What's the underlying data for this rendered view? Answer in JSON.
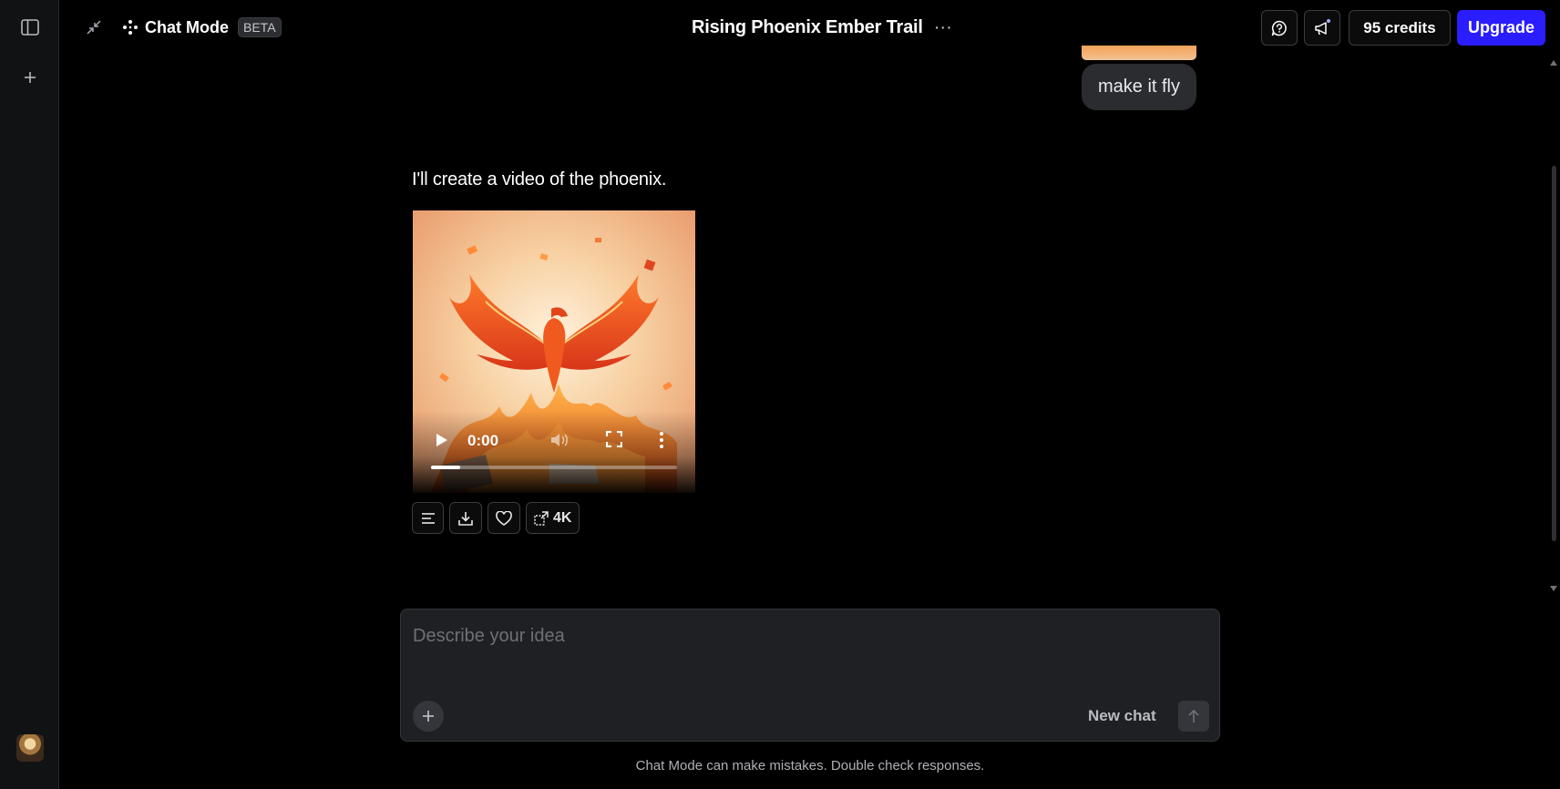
{
  "sidebar": {
    "toggle_icon": "sidebar-toggle-icon",
    "new_icon": "plus-icon",
    "avatar_icon": "user-avatar"
  },
  "header": {
    "mode_label": "Chat Mode",
    "beta_badge": "BETA",
    "chat_title": "Rising Phoenix Ember Trail",
    "credits": "95 credits",
    "upgrade_label": "Upgrade",
    "colors": {
      "upgrade_bg": "#2a1dff"
    }
  },
  "chat": {
    "user_message": "make it fly",
    "assistant_text": "I'll create a video of the phoenix.",
    "video": {
      "time": "0:00",
      "progress": 0.12
    },
    "actions": {
      "upscale_label": "4K"
    }
  },
  "composer": {
    "placeholder": "Describe your idea",
    "value": "",
    "new_chat_label": "New chat"
  },
  "footer": {
    "disclaimer": "Chat Mode can make mistakes. Double check responses."
  }
}
